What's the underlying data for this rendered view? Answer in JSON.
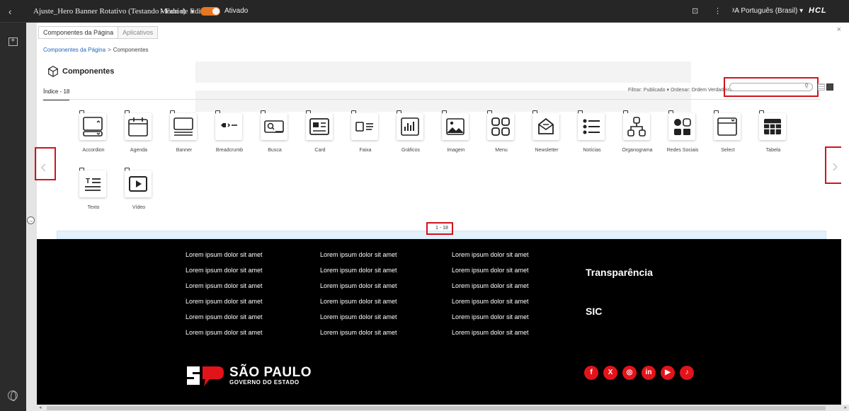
{
  "topbar": {
    "page_title": "Ajuste_Hero Banner Rotativo (Testando - Fabio)",
    "edit_mode_label": "Modo de Edição:",
    "edit_mode_state": "Ativado",
    "language": "Português (Brasil)",
    "brand": "HCL"
  },
  "panel": {
    "tabs": [
      "Componentes da Página",
      "Aplicativos"
    ],
    "breadcrumb": {
      "root": "Componentes da Página",
      "separator": ">",
      "current": "Componentes"
    },
    "title": "Componentes",
    "index_label": "Índice - 18",
    "filter": {
      "label": "Filtrar:",
      "value": "Publicado",
      "sort_label": "Ordenar:",
      "sort_value": "Ordem Verdadeira"
    },
    "search": {
      "value": "",
      "placeholder": ""
    },
    "pager": "1 - 18"
  },
  "components": [
    {
      "label": "Accordion",
      "icon": "accordion-icon"
    },
    {
      "label": "Agenda",
      "icon": "calendar-icon"
    },
    {
      "label": "Banner",
      "icon": "banner-icon"
    },
    {
      "label": "Breadcrumb",
      "icon": "breadcrumb-icon"
    },
    {
      "label": "Busca",
      "icon": "search-box-icon"
    },
    {
      "label": "Card",
      "icon": "card-icon"
    },
    {
      "label": "Faixa",
      "icon": "strip-icon"
    },
    {
      "label": "Gráficos",
      "icon": "chart-icon"
    },
    {
      "label": "Imagem",
      "icon": "image-icon"
    },
    {
      "label": "Menu",
      "icon": "menu-grid-icon"
    },
    {
      "label": "Newsletter",
      "icon": "newsletter-icon"
    },
    {
      "label": "Notícias",
      "icon": "news-list-icon"
    },
    {
      "label": "Organograma",
      "icon": "org-chart-icon"
    },
    {
      "label": "Redes Sociais",
      "icon": "social-media-icon"
    },
    {
      "label": "Select",
      "icon": "select-icon"
    },
    {
      "label": "Tabela",
      "icon": "table-icon"
    },
    {
      "label": "Texto",
      "icon": "text-icon"
    },
    {
      "label": "Vídeo",
      "icon": "video-icon"
    }
  ],
  "footer": {
    "columns": [
      [
        "Lorem ipsum dolor sit amet",
        "Lorem ipsum dolor sit amet",
        "Lorem ipsum dolor sit amet",
        "Lorem ipsum dolor sit amet",
        "Lorem ipsum dolor sit amet",
        "Lorem ipsum dolor sit amet"
      ],
      [
        "Lorem ipsum dolor sit amet",
        "Lorem ipsum dolor sit amet",
        "Lorem ipsum dolor sit amet",
        "Lorem ipsum dolor sit amet",
        "Lorem ipsum dolor sit amet",
        "Lorem ipsum dolor sit amet"
      ],
      [
        "Lorem ipsum dolor sit amet",
        "Lorem ipsum dolor sit amet",
        "Lorem ipsum dolor sit amet",
        "Lorem ipsum dolor sit amet",
        "Lorem ipsum dolor sit amet",
        "Lorem ipsum dolor sit amet"
      ]
    ],
    "links": [
      "Transparência",
      "SIC"
    ],
    "logo": {
      "title": "SÃO PAULO",
      "subtitle": "GOVERNO DO ESTADO"
    },
    "social": [
      {
        "name": "facebook-icon",
        "glyph": "f"
      },
      {
        "name": "x-icon",
        "glyph": "X"
      },
      {
        "name": "instagram-icon",
        "glyph": "◎"
      },
      {
        "name": "linkedin-icon",
        "glyph": "in"
      },
      {
        "name": "youtube-icon",
        "glyph": "▶"
      },
      {
        "name": "tiktok-icon",
        "glyph": "♪"
      }
    ]
  },
  "colors": {
    "accent": "#e87722",
    "highlight": "#d0141f",
    "social": "#e2141a",
    "link": "#2366b8"
  }
}
